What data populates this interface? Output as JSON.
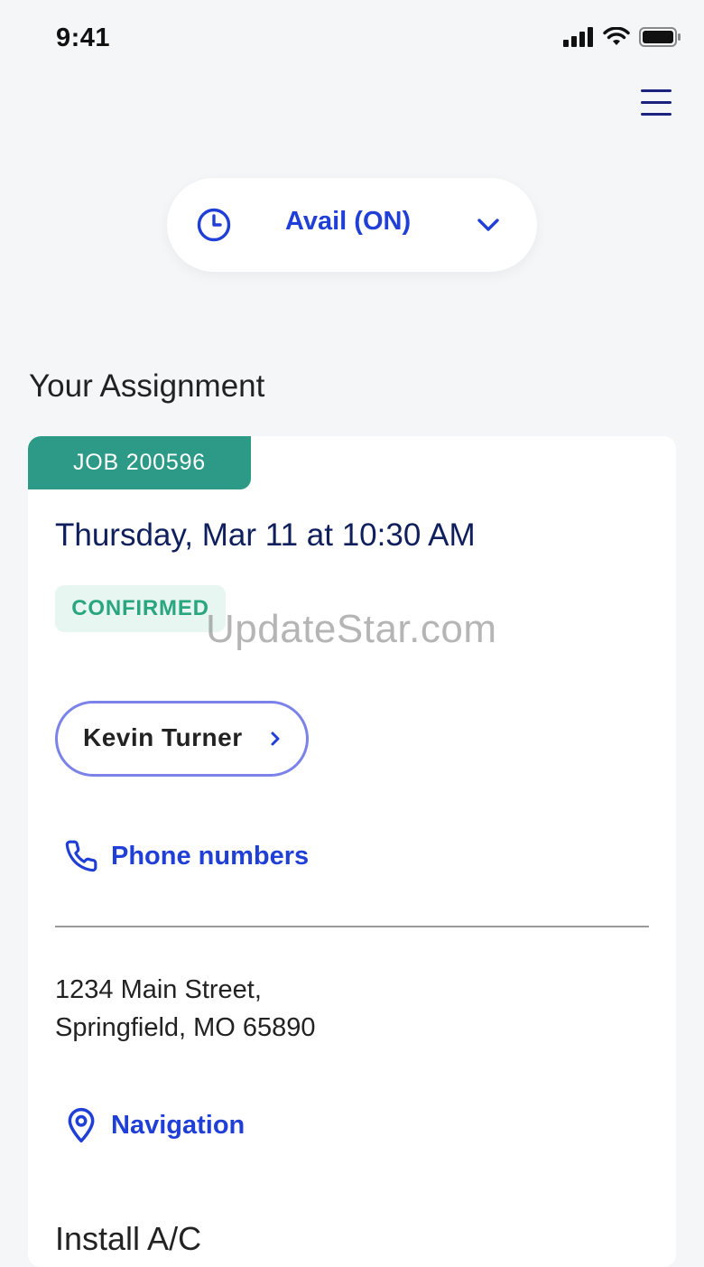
{
  "status_bar": {
    "time": "9:41",
    "icons": [
      "cellular-signal-icon",
      "wifi-icon",
      "battery-icon"
    ]
  },
  "header": {
    "menu_icon": "hamburger-menu-icon"
  },
  "availability": {
    "label": "Avail (ON)",
    "icon": "clock-icon",
    "dropdown_icon": "chevron-down-icon"
  },
  "section_title": "Your Assignment",
  "assignment": {
    "job_tag": "JOB 200596",
    "datetime": "Thursday, Mar 11 at 10:30 AM",
    "status": "CONFIRMED",
    "contact_name": "Kevin Turner",
    "phone_link": "Phone numbers",
    "address_line1": "1234 Main Street,",
    "address_line2": "Springfield, MO 65890",
    "navigation_link": "Navigation",
    "service": "Install A/C"
  },
  "watermark": "UpdateStar.com",
  "colors": {
    "accent_blue": "#1f3fd6",
    "navy": "#0f1f5c",
    "teal_tag": "#2c9a86",
    "confirmed_green": "#2aa67e",
    "confirmed_bg": "#e8f6f1",
    "pill_border": "#7b82e8"
  }
}
